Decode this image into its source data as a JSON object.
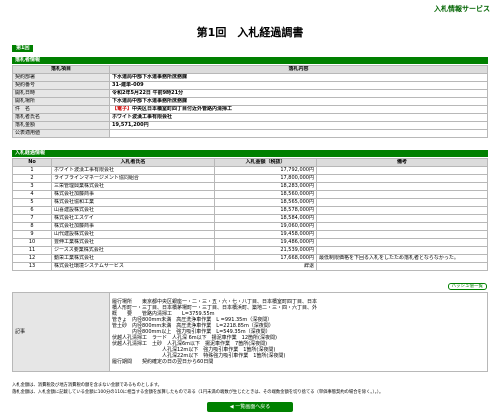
{
  "header": {
    "service_title": "入札情報サービス",
    "page_title": "第1回　入札経過調書",
    "round_tag": "第1回"
  },
  "info_section": {
    "title": "落札者情報",
    "col_item": "落札項目",
    "col_content": "落札内容",
    "rows": [
      {
        "label": "契約部署",
        "value": "下水道局中部下水道事務所庶務課"
      },
      {
        "label": "契約番号",
        "value": "31-建単-009"
      },
      {
        "label": "開札日時",
        "value": "令和2年5月22日 午前9時21分"
      },
      {
        "label": "開札場所",
        "value": "下水道局中部下水道事務所庶務課"
      },
      {
        "label": "件　名",
        "notice": "【電子】",
        "value": "中央区日本橋室町四丁目付近外管路内清掃工"
      },
      {
        "label": "落札者氏名",
        "value": "ホワイト波漢工事有限会社"
      },
      {
        "label": "落札金額",
        "value": "19,571,200円"
      },
      {
        "label": "公表適用値",
        "value": ""
      }
    ]
  },
  "list_section": {
    "title": "入札経過情報",
    "col_no": "No",
    "col_name": "入札者氏名",
    "col_amount": "入札金額（税抜）",
    "col_remarks": "備考",
    "rows": [
      {
        "no": "1",
        "name": "ホワイト波漢工事有限会社",
        "amount": "17,792,000円",
        "remark": ""
      },
      {
        "no": "2",
        "name": "ライフラインマネージメント協同組合",
        "amount": "17,800,000円",
        "remark": ""
      },
      {
        "no": "3",
        "name": "三栄管理興業株式会社",
        "amount": "18,283,000円",
        "remark": ""
      },
      {
        "no": "4",
        "name": "株式会社加藤商事",
        "amount": "18,560,000円",
        "remark": ""
      },
      {
        "no": "5",
        "name": "株式会社協和工業",
        "amount": "18,565,000円",
        "remark": ""
      },
      {
        "no": "6",
        "name": "山喜建設株式会社",
        "amount": "18,578,000円",
        "remark": ""
      },
      {
        "no": "7",
        "name": "株式会社エスケイ",
        "amount": "18,584,000円",
        "remark": ""
      },
      {
        "no": "8",
        "name": "株式会社加藤商事",
        "amount": "19,060,000円",
        "remark": ""
      },
      {
        "no": "9",
        "name": "山代建設株式会社",
        "amount": "19,458,000円",
        "remark": ""
      },
      {
        "no": "10",
        "name": "豊伸工業株式会社",
        "amount": "19,486,000円",
        "remark": ""
      },
      {
        "no": "11",
        "name": "ジースス要業株式会社",
        "amount": "21,539,000円",
        "remark": ""
      },
      {
        "no": "12",
        "name": "動栄工業株式会社",
        "amount": "17,668,000円",
        "remark": "最低制限価格を下回る入札をしたため落札者とならなかった。"
      },
      {
        "no": "13",
        "name": "株式会社環境システムサービス",
        "amount": "辞退",
        "remark": ""
      }
    ]
  },
  "hash_button": "ハッシュ値一覧",
  "remarks": {
    "label": "記事",
    "text": "履行場所　　東京都中央区銀座一・二・三・五・六・七・八丁目、日本橋室町四丁目、日本\n橋人形町一・三丁目、日本橋茅場町一・三丁目、日本橋浜町、築地二・三・四・六丁目、外\n概　　要　　管路内清掃工　　L=3759.55m\n管きょ　内径800mm未満　高圧洗浄車作業　L =991.35m（深夜間）\n管土砂　内径800mm未満　高圧洗浄車作業　L=2218.85m（深夜間）\n　　　　内径800mm以上　強力吸引車作業　L=549.35m（深夜間）\n伏越人孔清掃工　ラード　人孔深 6m以下　揚泥車作業　12箇所(深夜間)\n伏越人孔清掃工　土砂　人孔深6m以下　揚泥車作業　7箇所(深夜間)\n　　　　　　　　　　人孔深12m以下　強力吸引車作業　1箇所(深夜間)\n　　　　　　　　　　人孔深22m以下　特殊強力吸引車作業　1箇所(深夜間)\n履行期間　　契約確定の日の翌日から60日間"
  },
  "footnotes": [
    "入札金額は、消費税及び地方消費税の額を含まない金額であるものとします。",
    "落札金額は、入札金額に記載している金額に100分の110に相当する金額を加算したものである（1円未満の端数が生じたときは、その端数金額を切り捨てる（単価事態契約の場合を除く。）。）。"
  ],
  "back_button": "◀ 一覧画面へ戻る",
  "colors": {
    "accent": "#008000",
    "notice": "#cc0000"
  }
}
